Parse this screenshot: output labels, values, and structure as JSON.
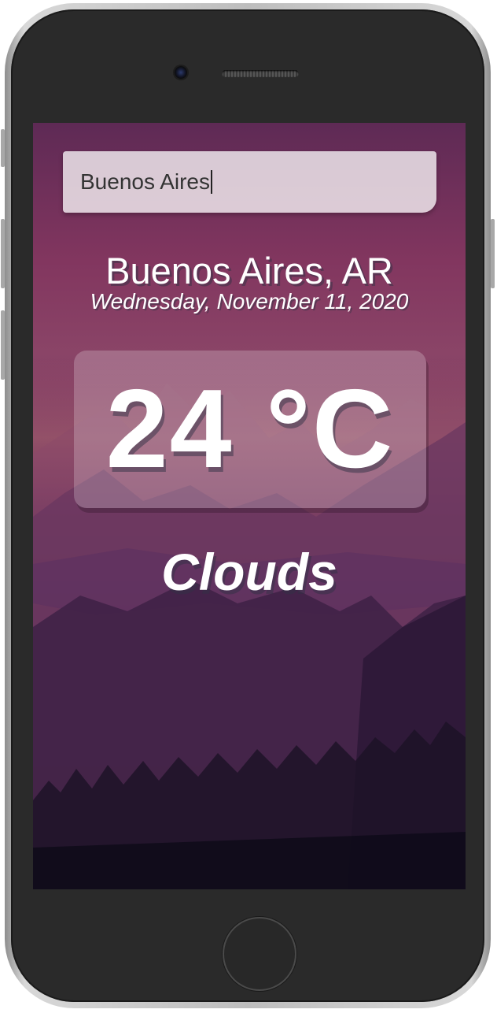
{
  "search": {
    "value": "Buenos Aires"
  },
  "location": {
    "city_country": "Buenos Aires, AR",
    "date": "Wednesday, November 11, 2020"
  },
  "weather": {
    "temperature": "24 °C",
    "condition": "Clouds"
  },
  "colors": {
    "background_top": "#5e2a55",
    "background_mid": "#8a4467",
    "background_bottom": "#0f0c1c",
    "text": "#ffffff",
    "phone_body": "#2a2a2a"
  }
}
